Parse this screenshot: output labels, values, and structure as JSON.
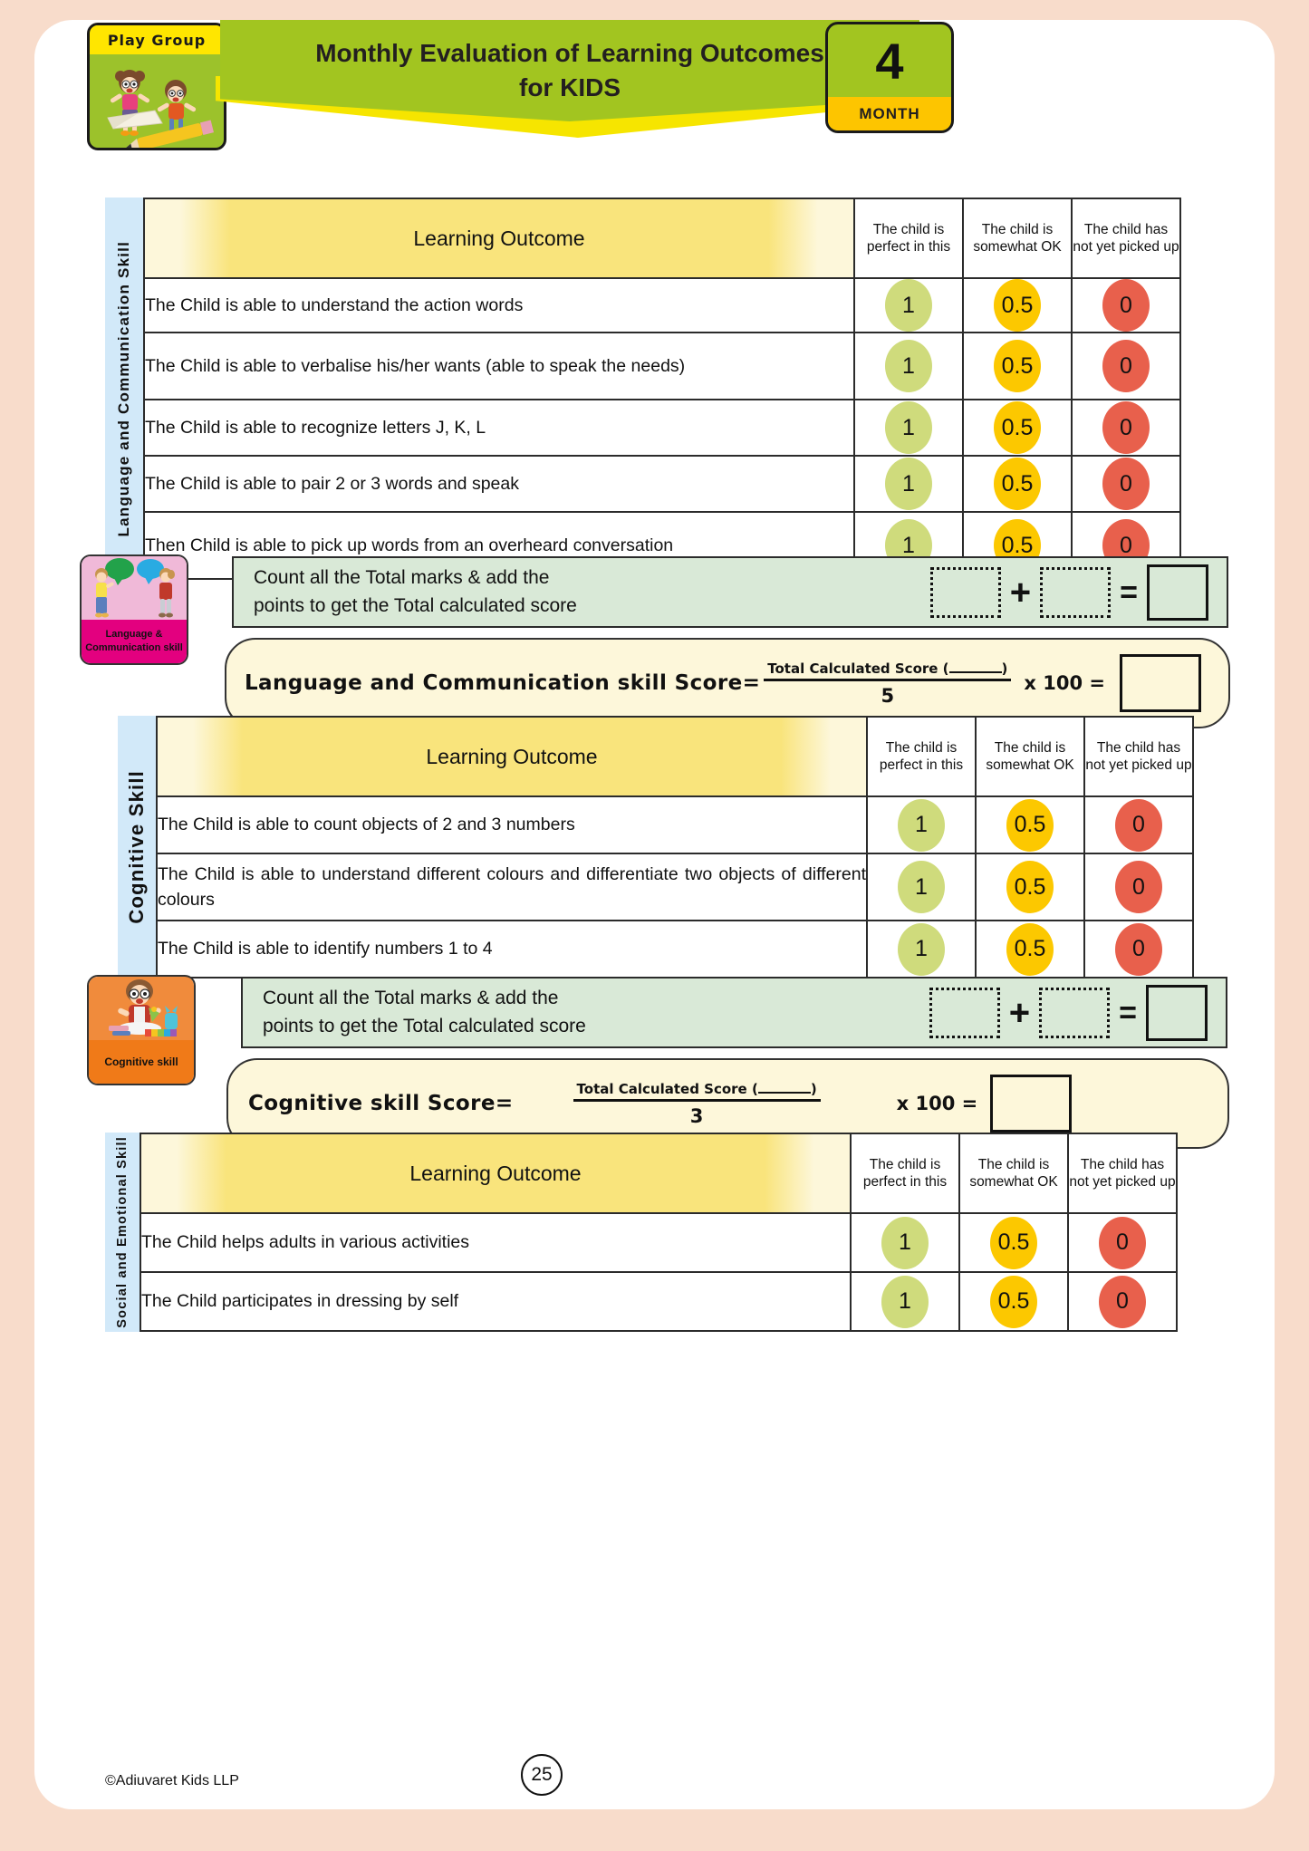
{
  "header": {
    "play_group_label": "Play Group",
    "title_line1": "Monthly Evaluation of Learning Outcomes",
    "title_line2": "for KIDS",
    "month_number": "4",
    "month_label": "MONTH"
  },
  "columns": {
    "outcome": "Learning Outcome",
    "perfect": "The child is perfect in this",
    "somewhat": "The child is somewhat OK",
    "notyet": "The child has not yet picked up"
  },
  "scores": {
    "perfect": "1",
    "somewhat": "0.5",
    "notyet": "0"
  },
  "colors": {
    "page_bg": "#f8dccb",
    "banner_green": "#a2c520",
    "banner_yellow": "#f6e500",
    "side_label_blue": "#d2e9f9",
    "header_yellow": "#f9e47c",
    "dot_green": "#cfdb7c",
    "dot_yellow": "#fcc800",
    "dot_red": "#e8604c",
    "count_box_green": "#d9e9d7",
    "formula_cream": "#fdf7da",
    "lang_icon_pink": "#e3007f",
    "cog_icon_orange": "#f07a18"
  },
  "sections": [
    {
      "side_label": "Language and Communication Skill",
      "rows": [
        "The Child is able to understand the action words",
        "The Child is able to verbalise his/her wants (able to speak the needs)",
        "The Child is able to recognize letters J, K, L",
        "The Child is able to pair 2 or 3 words and speak",
        "Then Child is able to pick up words from an overheard conversation"
      ],
      "icon_label": "Language & Communication skill",
      "count_text_line1": "Count all the Total marks & add the",
      "count_text_line2": "points to get the Total calculated score",
      "plus": "+",
      "equals": "=",
      "formula_label": "Language and Communication skill Score=",
      "formula_numerator": "Total Calculated Score (",
      "formula_numerator_close": ")",
      "formula_denominator": "5",
      "formula_multiplier": "x 100 ="
    },
    {
      "side_label": "Cognitive Skill",
      "rows": [
        "The Child is able to count objects of 2 and 3 numbers",
        "The Child is able to understand different colours and differentiate two objects of different colours",
        "The Child is able to identify numbers 1 to 4"
      ],
      "icon_label": "Cognitive skill",
      "count_text_line1": "Count all the Total marks & add the",
      "count_text_line2": "points to get the Total calculated score",
      "plus": "+",
      "equals": "=",
      "formula_label": "Cognitive skill Score=",
      "formula_numerator": "Total Calculated Score (",
      "formula_numerator_close": ")",
      "formula_denominator": "3",
      "formula_multiplier": "x 100 ="
    },
    {
      "side_label": "Social and Emotional Skill",
      "rows": [
        "The Child helps adults in various activities",
        "The Child participates in dressing by self"
      ]
    }
  ],
  "footer": {
    "copyright": "©Adiuvaret Kids LLP",
    "page_number": "25"
  }
}
